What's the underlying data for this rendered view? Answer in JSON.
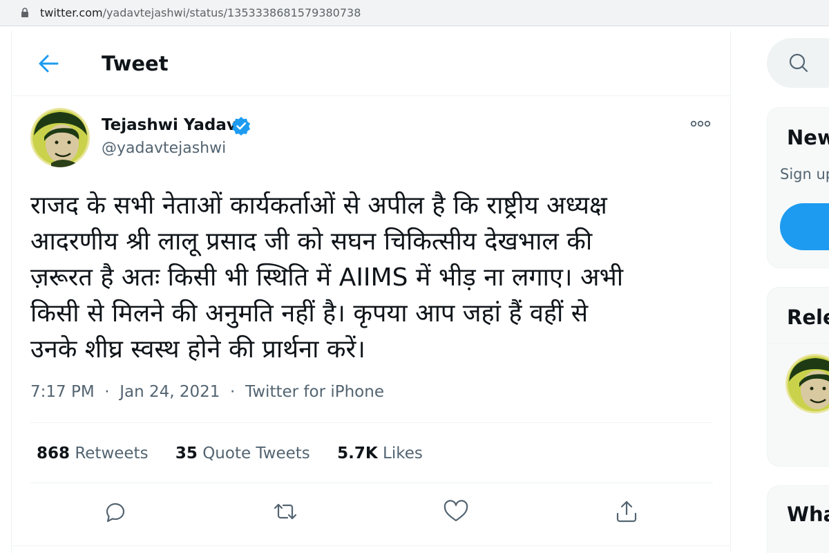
{
  "browser": {
    "url_host": "twitter.com",
    "url_path": "/yadavtejashwi/status/1353338681579380738"
  },
  "header": {
    "title": "Tweet"
  },
  "tweet": {
    "author_name": "Tejashwi Yadav",
    "author_handle": "@yadavtejashwi",
    "text_lines": [
      "राजद के सभी नेताओं कार्यकर्ताओं से अपील है कि राष्ट्रीय अध्यक्ष",
      "आदरणीय श्री लालू प्रसाद जी को सघन चिकित्सीय देखभाल की",
      "ज़रूरत है अतः किसी भी स्थिति में AIIMS में भीड़ ना लगाए। अभी",
      "किसी से मिलने की अनुमति नहीं है। कृपया आप जहां हैं वहीं से",
      "उनके शीघ्र स्वस्थ होने की प्रार्थना करें।"
    ],
    "time": "7:17 PM",
    "date": "Jan 24, 2021",
    "source": "Twitter for iPhone",
    "retweets_count": "868",
    "retweets_label": "Retweets",
    "quotes_count": "35",
    "quotes_label": "Quote Tweets",
    "likes_count": "5.7K",
    "likes_label": "Likes"
  },
  "sidebar": {
    "card1_title": "New",
    "card1_sub": "Sign up",
    "card2_title": "Rele",
    "card3_title": "Wha"
  },
  "icons": {
    "back": "arrow-left-icon",
    "verified": "verified-badge-icon",
    "more": "more-dots-icon",
    "reply": "reply-icon",
    "retweet": "retweet-icon",
    "like": "heart-icon",
    "share": "share-icon",
    "search": "search-icon",
    "lock": "lock-icon"
  },
  "colors": {
    "accent": "#1d9bf0",
    "text_primary": "#0f1419",
    "text_secondary": "#536471"
  }
}
